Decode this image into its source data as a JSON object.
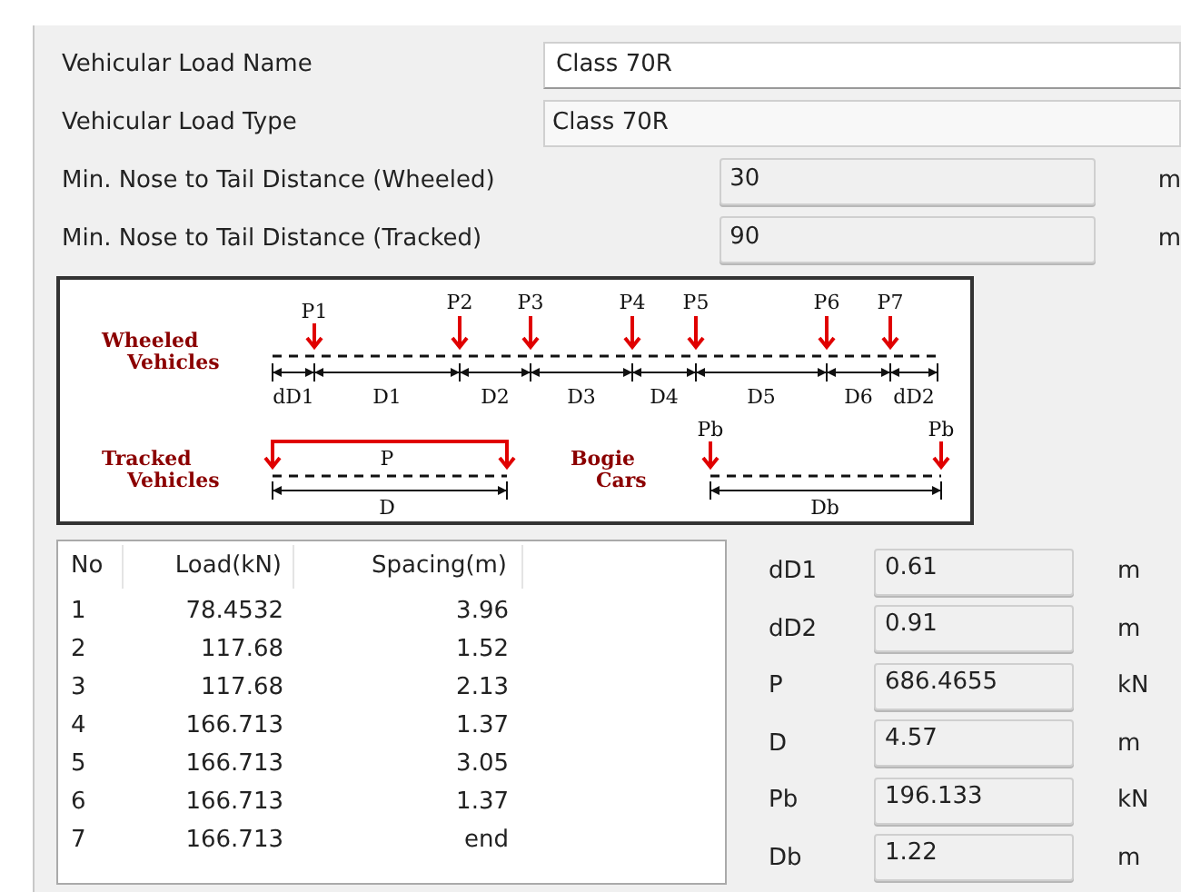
{
  "fields": [
    {
      "label": "Vehicular Load Name",
      "value": "Class 70R",
      "kind": "text"
    },
    {
      "label": "Vehicular Load Type",
      "value": "Class 70R",
      "kind": "combo"
    },
    {
      "label": "Min. Nose to Tail Distance (Wheeled)",
      "value": "30",
      "unit": "m",
      "kind": "number"
    },
    {
      "label": "Min. Nose to Tail Distance (Tracked)",
      "value": "90",
      "unit": "m",
      "kind": "number"
    }
  ],
  "diagram": {
    "wheeled": {
      "label": [
        "Wheeled",
        "Vehicles"
      ],
      "loads": [
        "P1",
        "P2",
        "P3",
        "P4",
        "P5",
        "P6",
        "P7"
      ],
      "spans": [
        "dD1",
        "D1",
        "D2",
        "D3",
        "D4",
        "D5",
        "D6",
        "dD2"
      ]
    },
    "tracked": {
      "label": [
        "Tracked",
        "Vehicles"
      ],
      "load": "P",
      "span": "D"
    },
    "bogie": {
      "label": [
        "Bogie",
        "Cars"
      ],
      "loads": [
        "Pb",
        "Pb"
      ],
      "span": "Db"
    }
  },
  "table": {
    "columns": [
      "No",
      "Load(kN)",
      "Spacing(m)"
    ],
    "rows": [
      [
        "1",
        "78.4532",
        "3.96"
      ],
      [
        "2",
        "117.68",
        "1.52"
      ],
      [
        "3",
        "117.68",
        "2.13"
      ],
      [
        "4",
        "166.713",
        "1.37"
      ],
      [
        "5",
        "166.713",
        "3.05"
      ],
      [
        "6",
        "166.713",
        "1.37"
      ],
      [
        "7",
        "166.713",
        "end"
      ]
    ]
  },
  "parameters": [
    {
      "label": "dD1",
      "value": "0.61",
      "unit": "m"
    },
    {
      "label": "dD2",
      "value": "0.91",
      "unit": "m"
    },
    {
      "label": "P",
      "value": "686.4655",
      "unit": "kN"
    },
    {
      "label": "D",
      "value": "4.57",
      "unit": "m"
    },
    {
      "label": "Pb",
      "value": "196.133",
      "unit": "kN"
    },
    {
      "label": "Db",
      "value": "1.22",
      "unit": "m"
    }
  ]
}
